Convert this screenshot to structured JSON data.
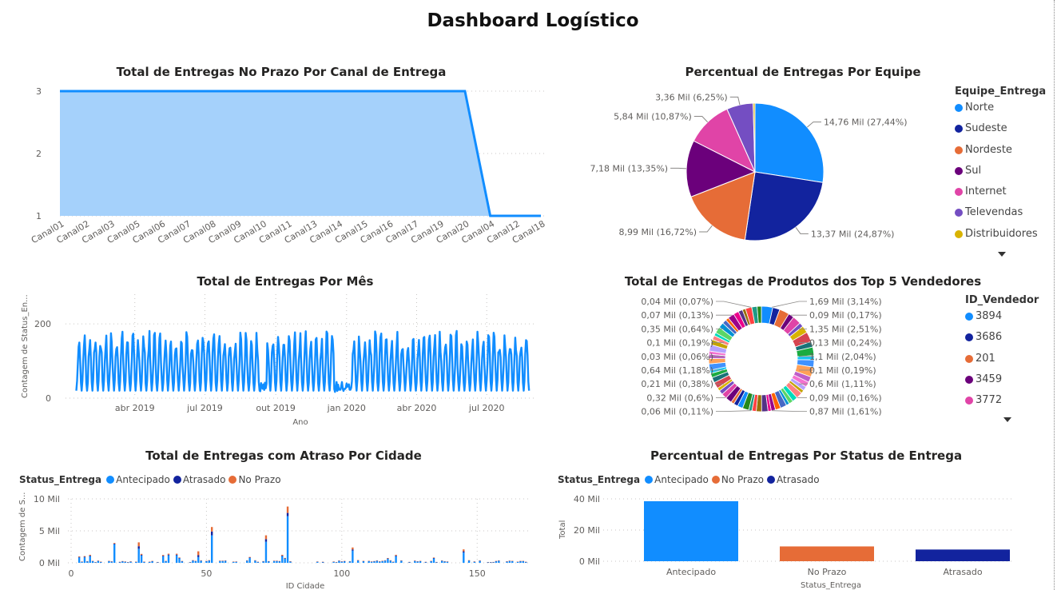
{
  "dashboard": {
    "title": "Dashboard Logístico"
  },
  "colors": {
    "blue": "#118DFF",
    "navy": "#12239E",
    "orange": "#E66C37",
    "purple": "#6B007B",
    "pink": "#E044A7",
    "violet": "#744EC2",
    "gold": "#D9B300",
    "area_fill": "#a5d1fb"
  },
  "chart_data": [
    {
      "id": "canal",
      "type": "area",
      "title": "Total de Entregas No Prazo Por Canal de Entrega",
      "categories": [
        "Canal01",
        "Canal02",
        "Canal03",
        "Canal05",
        "Canal06",
        "Canal07",
        "Canal08",
        "Canal09",
        "Canal10",
        "Canal11",
        "Canal13",
        "Canal14",
        "Canal15",
        "Canal16",
        "Canal17",
        "Canal19",
        "Canal20",
        "Canal04",
        "Canal12",
        "Canal18"
      ],
      "values": [
        3,
        3,
        3,
        3,
        3,
        3,
        3,
        3,
        3,
        3,
        3,
        3,
        3,
        3,
        3,
        3,
        3,
        1,
        1,
        1
      ],
      "y_ticks": [
        "1",
        "2",
        "3"
      ],
      "ylim": [
        1,
        3
      ],
      "grid": true
    },
    {
      "id": "equipe",
      "type": "pie",
      "title": "Percentual de Entregas Por Equipe",
      "legend_title": "Equipe_Entrega",
      "legend_position": "right",
      "slices": [
        {
          "name": "Norte",
          "value": 14.76,
          "label": "14,76 Mil (27,44%)",
          "color": "#118DFF"
        },
        {
          "name": "Sudeste",
          "value": 13.37,
          "label": "13,37 Mil (24,87%)",
          "color": "#12239E"
        },
        {
          "name": "Nordeste",
          "value": 8.99,
          "label": "8,99 Mil (16,72%)",
          "color": "#E66C37"
        },
        {
          "name": "Sul",
          "value": 7.18,
          "label": "7,18 Mil (13,35%)",
          "color": "#6B007B"
        },
        {
          "name": "Internet",
          "value": 5.84,
          "label": "5,84 Mil (10,87%)",
          "color": "#E044A7"
        },
        {
          "name": "Televendas",
          "value": 3.36,
          "label": "3,36 Mil (6,25%)",
          "color": "#744EC2"
        },
        {
          "name": "Distribuidores",
          "value": 0.23,
          "label": "",
          "color": "#D9B300"
        }
      ]
    },
    {
      "id": "mes",
      "type": "line",
      "title": "Total de Entregas Por Mês",
      "xlabel": "Ano",
      "ylabel": "Contagem de Status_En...",
      "x_ticks": [
        "abr 2019",
        "jul 2019",
        "out 2019",
        "jan 2020",
        "abr 2020",
        "jul 2020"
      ],
      "x_range": [
        "2019-01-01",
        "2020-08-31"
      ],
      "y_ticks": [
        "0",
        "200"
      ],
      "ylim": [
        0,
        280
      ],
      "color": "#118DFF"
    },
    {
      "id": "vendedores",
      "type": "pie",
      "variant": "donut",
      "title": "Total de Entregas de Produtos dos Top 5 Vendedores",
      "legend_title": "ID_Vendedor",
      "legend_position": "right",
      "legend_items": [
        {
          "name": "3894",
          "color": "#118DFF"
        },
        {
          "name": "3686",
          "color": "#12239E"
        },
        {
          "name": "201",
          "color": "#E66C37"
        },
        {
          "name": "3459",
          "color": "#6B007B"
        },
        {
          "name": "3772",
          "color": "#E044A7"
        }
      ],
      "labels_right": [
        "1,69 Mil (3,14%)",
        "0,09 Mil (0,17%)",
        "1,35 Mil (2,51%)",
        "0,13 Mil (0,24%)",
        "1,1 Mil (2,04%)",
        "0,1 Mil (0,19%)",
        "0,6 Mil (1,11%)",
        "0,09 Mil (0,16%)",
        "0,87 Mil (1,61%)"
      ],
      "labels_left": [
        "0,04 Mil (0,07%)",
        "0,07 Mil (0,13%)",
        "0,35 Mil (0,64%)",
        "0,1 Mil (0,19%)",
        "0,03 Mil (0,06%)",
        "0,64 Mil (1,18%)",
        "0,21 Mil (0,38%)",
        "0,32 Mil (0,6%)",
        "0,06 Mil (0,11%)"
      ]
    },
    {
      "id": "cidade",
      "type": "bar",
      "stacked": true,
      "title": "Total de Entregas com Atraso Por Cidade",
      "legend_title": "Status_Entrega",
      "legend_position": "top-left",
      "series_names": [
        "Antecipado",
        "Atrasado",
        "No Prazo"
      ],
      "series_colors": [
        "#118DFF",
        "#12239E",
        "#E66C37"
      ],
      "xlabel": "ID Cidade",
      "ylabel": "Contagem de S...",
      "x_ticks": [
        "0",
        "50",
        "100",
        "150"
      ],
      "xlim": [
        0,
        170
      ],
      "y_ticks": [
        "0 Mil",
        "5 Mil",
        "10 Mil"
      ],
      "ylim": [
        0,
        10
      ],
      "notable_bars": [
        {
          "x": 16,
          "values": [
            2.9,
            0.1,
            0.1
          ]
        },
        {
          "x": 25,
          "values": [
            2.2,
            0.4,
            0.6
          ]
        },
        {
          "x": 47,
          "values": [
            0.9,
            0.3,
            0.6
          ]
        },
        {
          "x": 52,
          "values": [
            4.3,
            0.6,
            0.7
          ]
        },
        {
          "x": 72,
          "values": [
            3.3,
            0.4,
            0.6
          ]
        },
        {
          "x": 80,
          "values": [
            7.3,
            0.5,
            1.0
          ]
        },
        {
          "x": 104,
          "values": [
            1.9,
            0.2,
            0.3
          ]
        },
        {
          "x": 145,
          "values": [
            1.6,
            0.2,
            0.3
          ]
        }
      ]
    },
    {
      "id": "status",
      "type": "bar",
      "title": "Percentual de Entregas Por Status de Entrega",
      "legend_title": "Status_Entrega",
      "legend_position": "top-left",
      "categories": [
        "Antecipado",
        "No Prazo",
        "Atrasado"
      ],
      "values": [
        38.5,
        9.5,
        7.5
      ],
      "colors": [
        "#118DFF",
        "#E66C37",
        "#12239E"
      ],
      "xlabel": "Status_Entrega",
      "ylabel": "Total",
      "y_ticks": [
        "0 Mil",
        "20 Mil",
        "40 Mil"
      ],
      "ylim": [
        0,
        40
      ]
    }
  ]
}
